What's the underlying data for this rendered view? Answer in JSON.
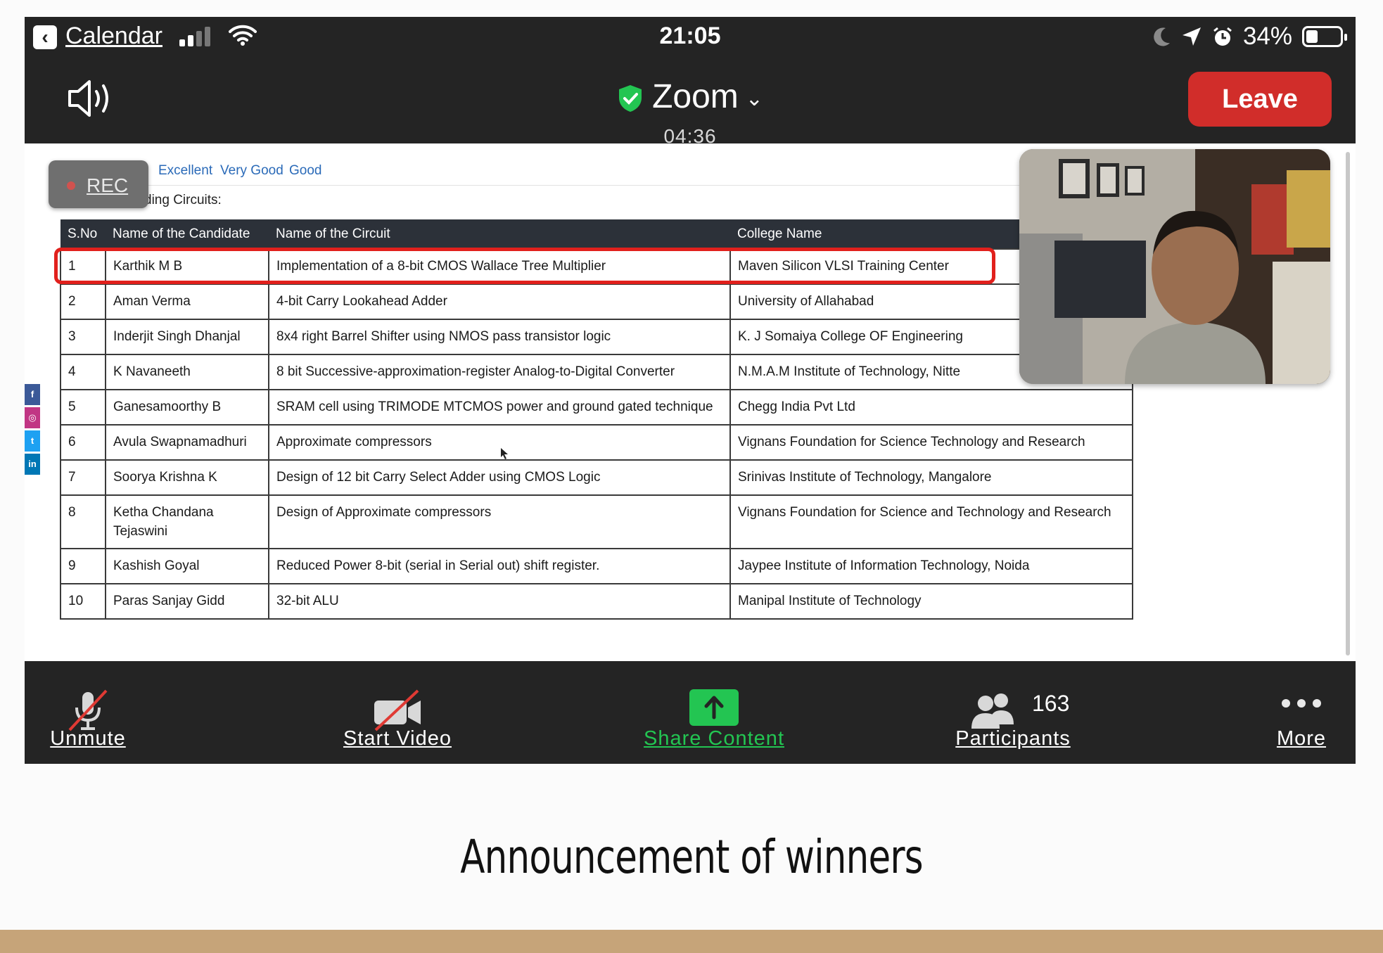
{
  "status_bar": {
    "back_app": "Calendar",
    "time": "21:05",
    "battery": "34%",
    "battery_level": 0.34
  },
  "zoom_header": {
    "title": "Zoom",
    "timer": "04:36",
    "leave_label": "Leave"
  },
  "rec_label": "REC",
  "tabs": [
    "Excellent",
    "Very Good",
    "Good"
  ],
  "subheading": "ding Circuits:",
  "table": {
    "headers": [
      "S.No",
      "Name of the Candidate",
      "Name of the Circuit",
      "College Name"
    ],
    "rows": [
      [
        "1",
        "Karthik M B",
        "Implementation of a 8-bit CMOS Wallace Tree Multiplier",
        "Maven Silicon VLSI Training Center"
      ],
      [
        "2",
        "Aman Verma",
        "4-bit Carry Lookahead Adder",
        "University of Allahabad"
      ],
      [
        "3",
        "Inderjit Singh Dhanjal",
        "8x4 right Barrel Shifter using NMOS pass transistor logic",
        "K. J Somaiya College OF Engineering"
      ],
      [
        "4",
        "K Navaneeth",
        "8 bit Successive-approximation-register Analog-to-Digital Converter",
        "N.M.A.M Institute of Technology, Nitte"
      ],
      [
        "5",
        "Ganesamoorthy B",
        "SRAM cell using TRIMODE MTCMOS power and ground gated technique",
        "Chegg India Pvt Ltd"
      ],
      [
        "6",
        "Avula Swapnamadhuri",
        "Approximate compressors",
        "Vignans Foundation for Science Technology and Research"
      ],
      [
        "7",
        "Soorya Krishna K",
        "Design of 12 bit Carry Select Adder using CMOS Logic",
        "Srinivas Institute of Technology, Mangalore"
      ],
      [
        "8",
        "Ketha Chandana Tejaswini",
        "Design of Approximate compressors",
        "Vignans Foundation for Science and Technology and Research"
      ],
      [
        "9",
        "Kashish Goyal",
        "Reduced Power 8-bit (serial in Serial out) shift register.",
        "Jaypee Institute of Information Technology, Noida"
      ],
      [
        "10",
        "Paras Sanjay Gidd",
        "32-bit ALU",
        "Manipal Institute of Technology"
      ]
    ]
  },
  "toolbar": {
    "unmute": "Unmute",
    "start_video": "Start Video",
    "share_content": "Share Content",
    "participants": "Participants",
    "participant_count": "163",
    "more": "More"
  },
  "caption": "Announcement of winners",
  "colors": {
    "leave": "#d12d2a",
    "share": "#23c552",
    "highlight": "#e1201c",
    "footer": "#c6a479"
  }
}
